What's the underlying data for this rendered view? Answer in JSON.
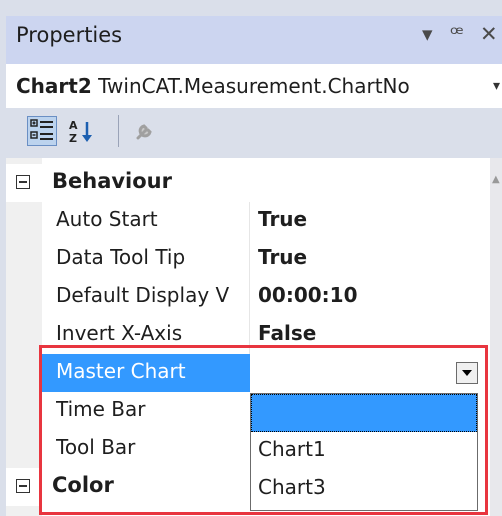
{
  "window": {
    "title": "Properties",
    "pin_glyph": "▾ ᵽ ✕"
  },
  "object_selector": {
    "name": "Chart2",
    "type": "TwinCAT.Measurement.ChartNo"
  },
  "toolbar": {
    "categorized_icon": "categorized-icon",
    "alphabetical_icon": "alphabetical-icon",
    "property_pages_icon": "wrench-icon"
  },
  "categories": [
    {
      "label": "Behaviour",
      "properties": [
        {
          "name": "Auto Start",
          "value": "True"
        },
        {
          "name": "Data Tool Tip",
          "value": "True"
        },
        {
          "name": "Default Display V",
          "value": "00:00:10"
        },
        {
          "name": "Invert X-Axis",
          "value": "False"
        },
        {
          "name": "Master Chart",
          "value": ""
        },
        {
          "name": "Time Bar",
          "value": ""
        },
        {
          "name": "Tool Bar",
          "value": ""
        }
      ]
    },
    {
      "label": "Color",
      "properties": []
    }
  ],
  "dropdown": {
    "options": [
      "",
      "Chart1",
      "Chart3"
    ],
    "selected_index": 0
  },
  "colors": {
    "selection": "#3399ff",
    "highlight_box": "#e8353f"
  }
}
